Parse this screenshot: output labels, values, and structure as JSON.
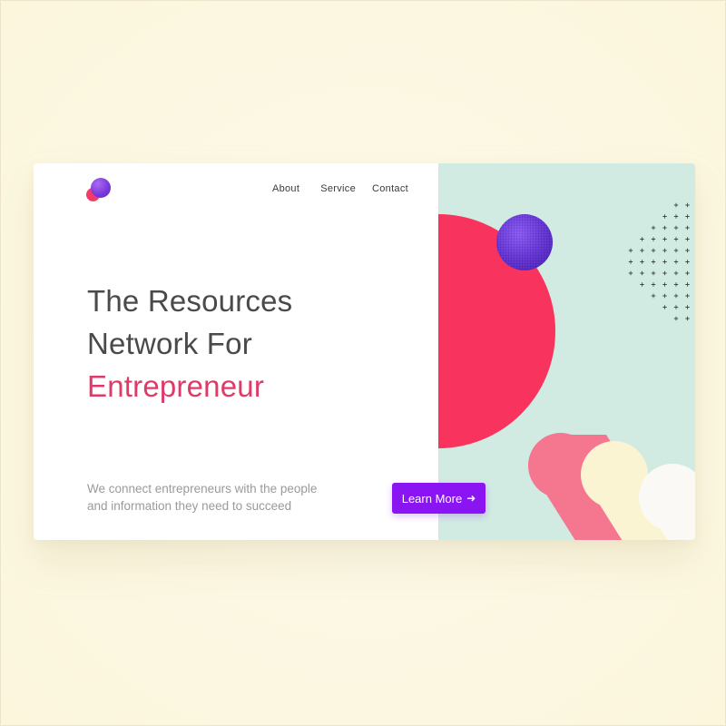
{
  "nav": {
    "about": "About",
    "service": "Service",
    "contact": "Contact"
  },
  "hero": {
    "headline_line1": "The Resources",
    "headline_line2": "Network For",
    "headline_accent": "Entrepreneur",
    "subtext_line1": "We connect entrepreneurs with the people",
    "subtext_line2": "and information they need to succeed",
    "cta_label": "Learn More",
    "cta_arrow": "➜"
  },
  "colors": {
    "page_background": "#fdf8e4",
    "card_background": "#ffffff",
    "illustration_background": "#d1ebe2",
    "accent_pink": "#e03a68",
    "big_circle_red": "#f7335e",
    "button_purple": "#8a14f2",
    "sphere_purple": "#6a3ad6",
    "pill_pink": "#f4768f",
    "pill_cream": "#fbf4d2",
    "pill_white": "#fbf9f6",
    "text_dark": "#4a4a4a",
    "text_muted": "#9a9a9a"
  },
  "icons": {
    "logo": "two-overlapping-circles-logo",
    "cta": "arrow-right-icon"
  }
}
